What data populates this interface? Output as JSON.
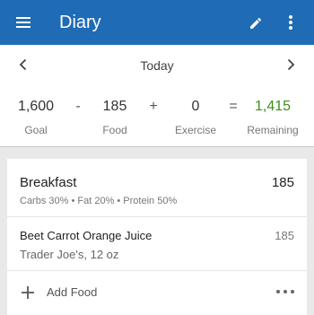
{
  "appbar": {
    "title": "Diary",
    "menu_icon": "menu-icon",
    "edit_icon": "pencil-icon",
    "more_icon": "more-vert-icon",
    "color": "#1f6bb5"
  },
  "datebar": {
    "label": "Today",
    "prev_icon": "chevron-left-icon",
    "next_icon": "chevron-right-icon"
  },
  "summary": {
    "goal": {
      "value": "1,600",
      "label": "Goal"
    },
    "op1": "-",
    "food": {
      "value": "185",
      "label": "Food"
    },
    "op2": "+",
    "exercise": {
      "value": "0",
      "label": "Exercise"
    },
    "op3": "=",
    "remaining": {
      "value": "1,415",
      "label": "Remaining",
      "color": "#3d8f1c"
    }
  },
  "meal": {
    "title": "Breakfast",
    "calories": "185",
    "macros": "Carbs 30% • Fat 20% • Protein 50%",
    "items": [
      {
        "name": "Beet Carrot Orange Juice",
        "description": "Trader Joe's, 12 oz",
        "calories": "185"
      }
    ],
    "add_label": "Add Food",
    "add_icon": "plus-icon",
    "more_icon": "more-horiz-icon"
  }
}
